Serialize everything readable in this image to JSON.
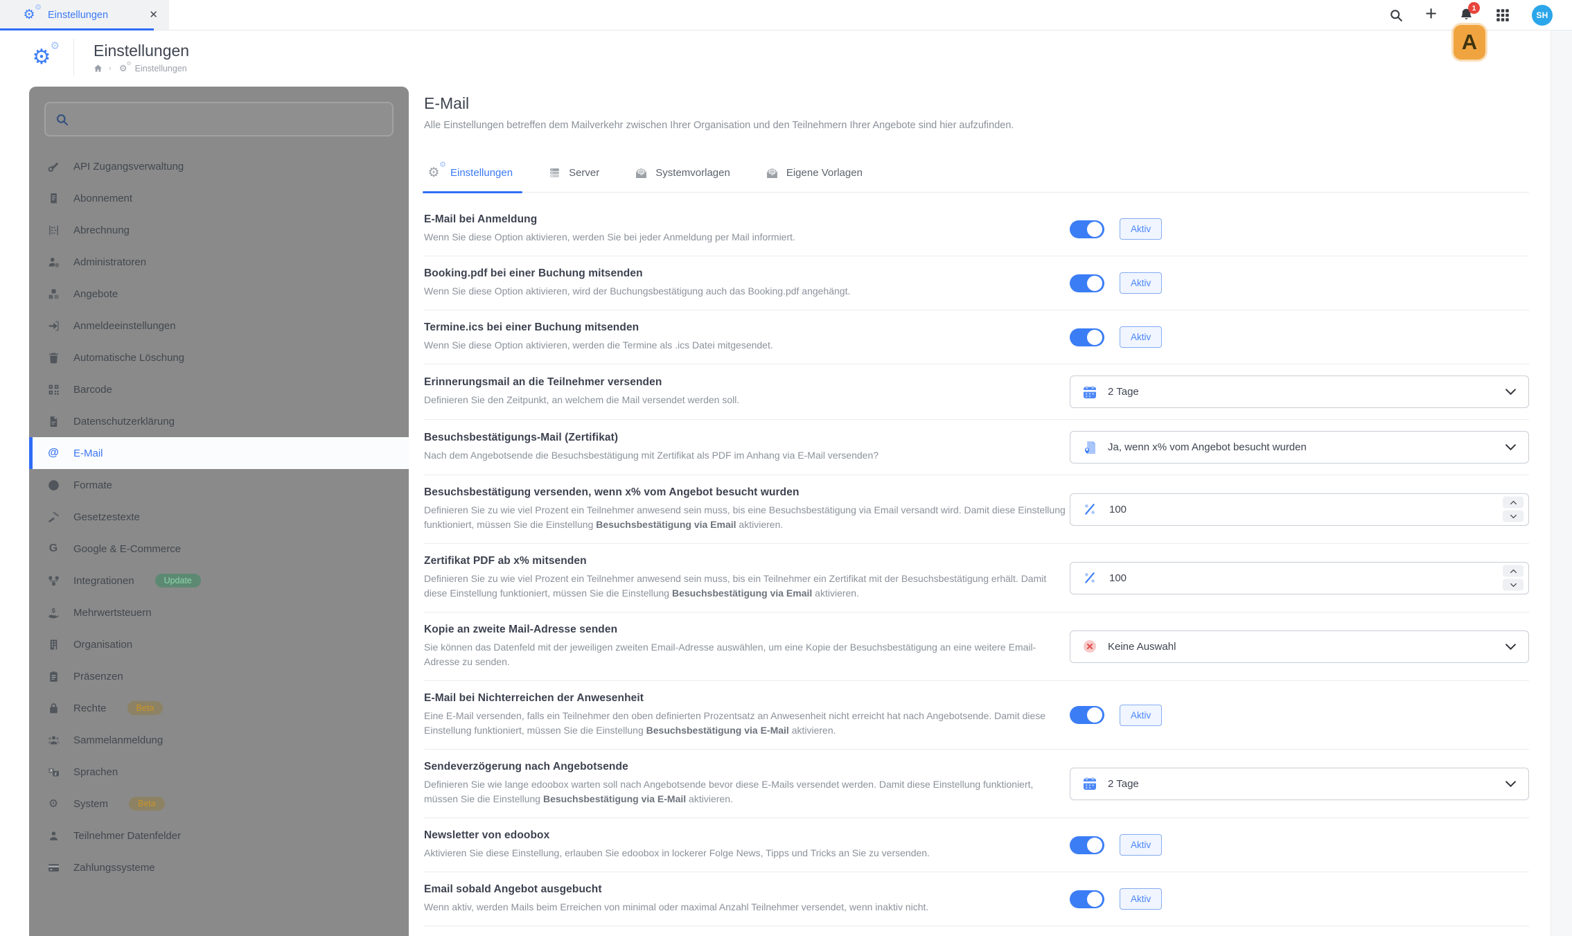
{
  "topbar": {
    "tab_label": "Einstellungen",
    "notification_count": "1",
    "avatar_initials": "SH"
  },
  "header": {
    "title": "Einstellungen",
    "breadcrumb_current": "Einstellungen"
  },
  "annotation": {
    "label": "A"
  },
  "sidebar": {
    "search_placeholder": "",
    "items": [
      {
        "key": "api-zugangsverwaltung",
        "label": "API Zugangsverwaltung",
        "icon": "key"
      },
      {
        "key": "abonnement",
        "label": "Abonnement",
        "icon": "receipt"
      },
      {
        "key": "abrechnung",
        "label": "Abrechnung",
        "icon": "abacus"
      },
      {
        "key": "administratoren",
        "label": "Administratoren",
        "icon": "admin-user"
      },
      {
        "key": "angebote",
        "label": "Angebote",
        "icon": "cubes"
      },
      {
        "key": "anmeldeeinstellungen",
        "label": "Anmeldeeinstellungen",
        "icon": "login-arrow"
      },
      {
        "key": "automatische-loeschung",
        "label": "Automatische Löschung",
        "icon": "trash"
      },
      {
        "key": "barcode",
        "label": "Barcode",
        "icon": "qr-code"
      },
      {
        "key": "datenschutzerklaerung",
        "label": "Datenschutzerklärung",
        "icon": "document"
      },
      {
        "key": "e-mail",
        "label": "E-Mail",
        "icon": "at-sign",
        "selected": true
      },
      {
        "key": "formate",
        "label": "Formate",
        "icon": "globe"
      },
      {
        "key": "gesetzestexte",
        "label": "Gesetzestexte",
        "icon": "gavel"
      },
      {
        "key": "google-e-commerce",
        "label": "Google & E-Commerce",
        "icon": "google-g"
      },
      {
        "key": "integrationen",
        "label": "Integrationen",
        "icon": "integration-nodes",
        "badge": {
          "text": "Update",
          "type": "update"
        }
      },
      {
        "key": "mehrwertsteuern",
        "label": "Mehrwertsteuern",
        "icon": "hand-dollar"
      },
      {
        "key": "organisation",
        "label": "Organisation",
        "icon": "building"
      },
      {
        "key": "praesenzen",
        "label": "Präsenzen",
        "icon": "clipboard"
      },
      {
        "key": "rechte",
        "label": "Rechte",
        "icon": "lock",
        "badge": {
          "text": "Beta",
          "type": "beta"
        }
      },
      {
        "key": "sammelanmeldung",
        "label": "Sammelanmeldung",
        "icon": "user-group"
      },
      {
        "key": "sprachen",
        "label": "Sprachen",
        "icon": "translate"
      },
      {
        "key": "system",
        "label": "System",
        "icon": "gear",
        "badge": {
          "text": "Beta",
          "type": "beta"
        }
      },
      {
        "key": "teilnehmer-datenfelder",
        "label": "Teilnehmer Datenfelder",
        "icon": "user"
      },
      {
        "key": "zahlungssysteme",
        "label": "Zahlungssysteme",
        "icon": "credit-card"
      }
    ]
  },
  "main": {
    "title": "E-Mail",
    "subtitle": "Alle Einstellungen betreffen dem Mailverkehr zwischen Ihrer Organisation und den Teilnehmern Ihrer Angebote sind hier aufzufinden.",
    "tabs": [
      {
        "key": "einstellungen",
        "label": "Einstellungen",
        "icon": "gears",
        "active": true
      },
      {
        "key": "server",
        "label": "Server",
        "icon": "server"
      },
      {
        "key": "systemvorlagen",
        "label": "Systemvorlagen",
        "icon": "mail-open"
      },
      {
        "key": "eigene-vorlagen",
        "label": "Eigene Vorlagen",
        "icon": "mail-open"
      }
    ],
    "rows": [
      {
        "key": "email-bei-anmeldung",
        "title": "E-Mail bei Anmeldung",
        "desc": [
          {
            "t": "Wenn Sie diese Option aktivieren, werden Sie bei jeder Anmeldung per Mail informiert."
          }
        ],
        "control": {
          "type": "toggle",
          "state": true,
          "label": "Aktiv"
        }
      },
      {
        "key": "booking-pdf-mitsenden",
        "title": "Booking.pdf bei einer Buchung mitsenden",
        "desc": [
          {
            "t": "Wenn Sie diese Option aktivieren, wird der Buchungsbestätigung auch das Booking.pdf angehängt."
          }
        ],
        "control": {
          "type": "toggle",
          "state": true,
          "label": "Aktiv"
        }
      },
      {
        "key": "termine-ics-mitsenden",
        "title": "Termine.ics bei einer Buchung mitsenden",
        "desc": [
          {
            "t": "Wenn Sie diese Option aktivieren, werden die Termine als .ics Datei mitgesendet."
          }
        ],
        "control": {
          "type": "toggle",
          "state": true,
          "label": "Aktiv"
        }
      },
      {
        "key": "erinnerungsmail",
        "title": "Erinnerungsmail an die Teilnehmer versenden",
        "desc": [
          {
            "t": "Definieren Sie den Zeitpunkt, an welchem die Mail versendet werden soll."
          }
        ],
        "control": {
          "type": "select",
          "value": "2 Tage",
          "icon": "calendar"
        }
      },
      {
        "key": "besuchsbestaetigungs-mail-zertifikat",
        "title": "Besuchsbestätigungs-Mail (Zertifikat)",
        "desc": [
          {
            "t": "Nach dem Angebotsende die Besuchsbestätigung mit Zertifikat als PDF im Anhang via E-Mail versenden?"
          }
        ],
        "control": {
          "type": "select",
          "value": "Ja, wenn x% vom Angebot besucht wurden",
          "icon": "certificate"
        }
      },
      {
        "key": "besuchsbestaetigung-versenden-x-prozent",
        "title": "Besuchsbestätigung versenden, wenn x% vom Angebot besucht wurden",
        "desc": [
          {
            "t": "Definieren Sie zu wie viel Prozent ein Teilnehmer anwesend sein muss, bis eine Besuchsbestätigung via Email versandt wird. Damit diese Einstellung funktioniert, müssen Sie die Einstellung "
          },
          {
            "t": "Besuchsbestätigung via Email",
            "b": true
          },
          {
            "t": " aktivieren."
          }
        ],
        "control": {
          "type": "number",
          "value": "100",
          "icon": "percent"
        }
      },
      {
        "key": "zertifikat-pdf-ab-x-prozent",
        "title": "Zertifikat PDF ab x% mitsenden",
        "desc": [
          {
            "t": "Definieren Sie zu wie viel Prozent ein Teilnehmer anwesend sein muss, bis ein Teilnehmer ein Zertifikat mit der Besuchsbestätigung erhält. Damit diese Einstellung funktioniert, müssen Sie die Einstellung "
          },
          {
            "t": "Besuchsbestätigung via Email",
            "b": true
          },
          {
            "t": " aktivieren."
          }
        ],
        "control": {
          "type": "number",
          "value": "100",
          "icon": "percent"
        }
      },
      {
        "key": "kopie-zweite-mail-adresse",
        "title": "Kopie an zweite Mail-Adresse senden",
        "desc": [
          {
            "t": "Sie können das Datenfeld mit der jeweiligen zweiten Email-Adresse auswählen, um eine Kopie der Besuchsbestätigung an eine weitere Email-Adresse zu senden."
          }
        ],
        "control": {
          "type": "select",
          "value": "Keine Auswahl",
          "icon": "none-x"
        }
      },
      {
        "key": "email-nichterreichen-anwesenheit",
        "title": "E-Mail bei Nichterreichen der Anwesenheit",
        "desc": [
          {
            "t": "Eine E-Mail versenden, falls ein Teilnehmer den oben definierten Prozentsatz an Anwesenheit nicht erreicht hat nach Angebotsende. Damit diese Einstellung funktioniert, müssen Sie die Einstellung "
          },
          {
            "t": "Besuchsbestätigung via E-Mail",
            "b": true
          },
          {
            "t": " aktivieren."
          }
        ],
        "control": {
          "type": "toggle",
          "state": true,
          "label": "Aktiv"
        }
      },
      {
        "key": "sendeverzoegerung-angebotsende",
        "title": "Sendeverzögerung nach Angebotsende",
        "desc": [
          {
            "t": "Definieren Sie wie lange edoobox warten soll nach Angebotsende bevor diese E-Mails versendet werden. Damit diese Einstellung funktioniert, müssen Sie die Einstellung "
          },
          {
            "t": "Besuchsbestätigung via E-Mail",
            "b": true
          },
          {
            "t": " aktivieren."
          }
        ],
        "control": {
          "type": "select",
          "value": "2 Tage",
          "icon": "calendar"
        }
      },
      {
        "key": "newsletter-edoobox",
        "title": "Newsletter von edoobox",
        "desc": [
          {
            "t": "Aktivieren Sie diese Einstellung, erlauben Sie edoobox in lockerer Folge News, Tipps und Tricks an Sie zu versenden."
          }
        ],
        "control": {
          "type": "toggle",
          "state": true,
          "label": "Aktiv"
        }
      },
      {
        "key": "email-angebot-ausgebucht",
        "title": "Email sobald Angebot ausgebucht",
        "desc": [
          {
            "t": "Wenn aktiv, werden Mails beim Erreichen von minimal oder maximal Anzahl Teilnehmer versendet, wenn inaktiv nicht."
          }
        ],
        "control": {
          "type": "toggle",
          "state": true,
          "label": "Aktiv"
        }
      }
    ]
  },
  "colors": {
    "primary_blue": "#3b7df5",
    "toggle_on": "#3b7df5",
    "notification_red": "#e8453c",
    "avatar_blue": "#2ba6ea",
    "annotation_orange": "#f0a440",
    "badge_update_bg": "#5d8973",
    "badge_update_text": "#8ed7ad",
    "badge_beta_bg": "#8d8264",
    "badge_beta_text": "#c99527",
    "sidebar_dim": "#8a8a8a"
  }
}
